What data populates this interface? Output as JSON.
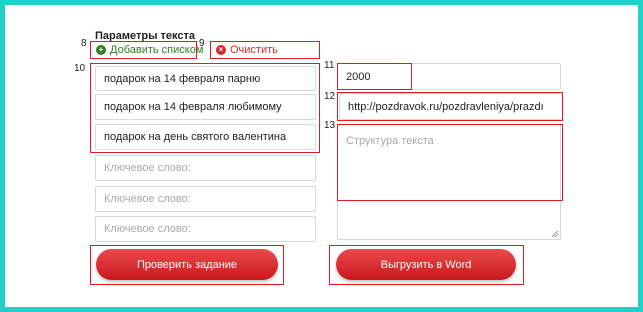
{
  "form": {
    "title": "Параметры текста",
    "add_list_label": "Добавить списком",
    "clear_label": "Очистить",
    "keywords": [
      "подарок на 14 февраля парню",
      "подарок на 14 февраля любимому",
      "подарок на день святого валентина"
    ],
    "keyword_placeholder": "Ключевое слово:",
    "char_count": "2000",
    "url": "http://pozdravok.ru/pozdravleniya/prazdı",
    "structure_placeholder": "Структура текста",
    "check_button": "Проверить задание",
    "export_button": "Выгрузить в Word"
  },
  "annotations": [
    "8",
    "9",
    "10",
    "11",
    "12",
    "13"
  ],
  "colors": {
    "frame": "#1fd1c8",
    "highlight": "#e11b22",
    "button": "#d6262a",
    "add_link": "#2f7d24",
    "clear_link": "#d42b2b"
  }
}
